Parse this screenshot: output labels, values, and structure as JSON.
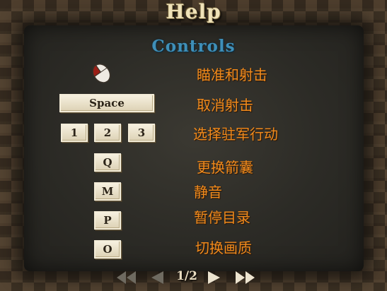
{
  "window": {
    "title": "Help",
    "section": "Controls"
  },
  "controls": [
    {
      "keys": [],
      "icon": "mouse-left-click-icon",
      "label": "瞄准和射击"
    },
    {
      "keys": [
        "Space"
      ],
      "label": "取消射击"
    },
    {
      "keys": [
        "1",
        "2",
        "3"
      ],
      "label": "选择驻军行动"
    },
    {
      "keys": [
        "Q"
      ],
      "label": "更换箭囊"
    },
    {
      "keys": [
        "M"
      ],
      "label": "静音"
    },
    {
      "keys": [
        "P"
      ],
      "label": "暂停目录"
    },
    {
      "keys": [
        "O"
      ],
      "label": "切换画质"
    }
  ],
  "pagination": {
    "page": "1/2",
    "first_icon": "double-left-arrow-icon",
    "prev_icon": "left-arrow-icon",
    "next_icon": "right-arrow-icon",
    "last_icon": "double-right-arrow-icon"
  },
  "colors": {
    "title": "#efe2b8",
    "subtitle": "#3f8fb8",
    "label": "#f08a1c",
    "key_face": "#f6f0df",
    "disabled_arrow": "#6e6a60",
    "active_arrow": "#ece3cf"
  }
}
